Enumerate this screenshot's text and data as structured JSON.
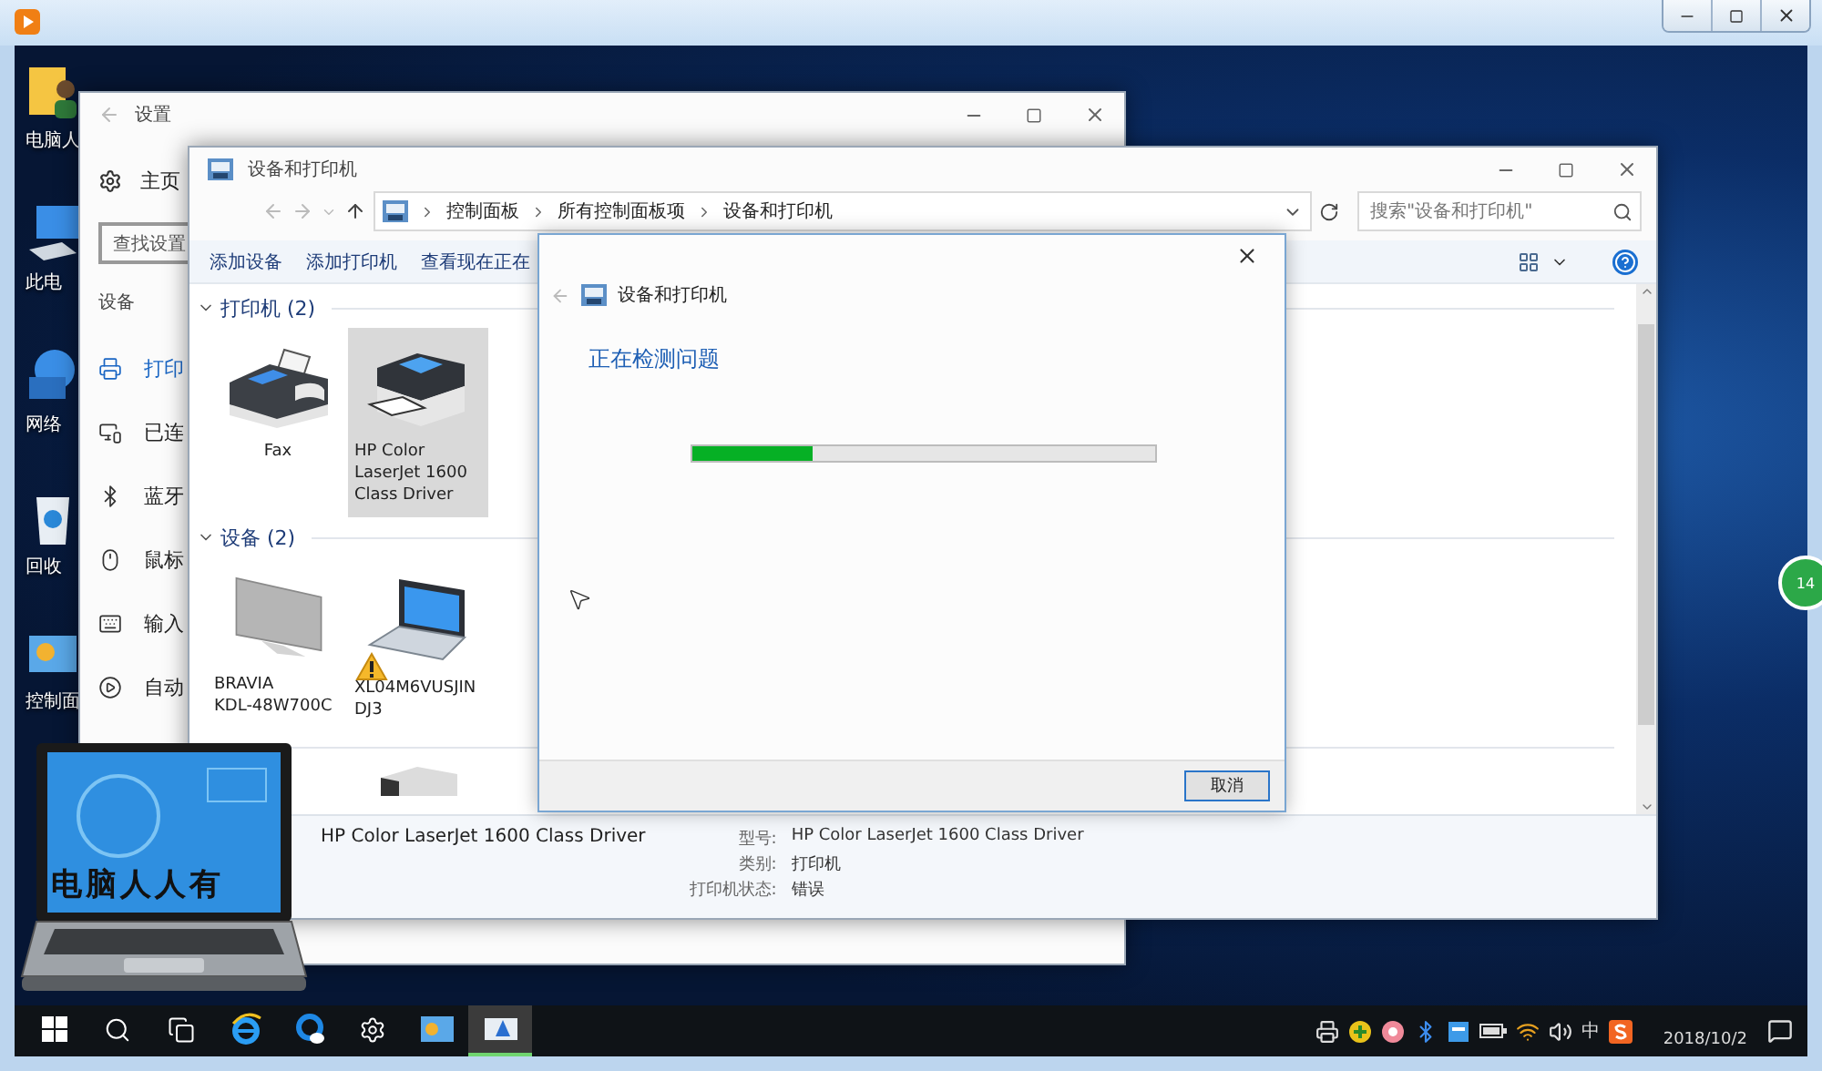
{
  "badge": {
    "text": "14"
  },
  "desktop_icons": [
    {
      "kind": "user-folder",
      "label": "电脑人"
    },
    {
      "kind": "pc",
      "label": "此电"
    },
    {
      "kind": "network",
      "label": "网络"
    },
    {
      "kind": "recycle",
      "label": "回收"
    },
    {
      "kind": "control-panel",
      "label": "控制面"
    }
  ],
  "settings_window": {
    "title": "设置",
    "home": "主页",
    "search": {
      "placeholder": "查找设置"
    },
    "section": "设备",
    "nav": [
      {
        "kind": "printer",
        "label": "打印",
        "selected": true
      },
      {
        "kind": "devices",
        "label": "已连",
        "selected": false
      },
      {
        "kind": "bluetooth",
        "label": "蓝牙",
        "selected": false
      },
      {
        "kind": "mouse",
        "label": "鼠标",
        "selected": false
      },
      {
        "kind": "keyboard",
        "label": "输入",
        "selected": false
      },
      {
        "kind": "autoplay",
        "label": "自动",
        "selected": false
      }
    ]
  },
  "explorer": {
    "title": "设备和打印机",
    "breadcrumb": [
      "控制面板",
      "所有控制面板项",
      "设备和打印机"
    ],
    "search": {
      "placeholder": "搜索\"设备和打印机\""
    },
    "toolbar": [
      "添加设备",
      "添加打印机",
      "查看现在正在"
    ],
    "groups": [
      {
        "title": "打印机 (2)",
        "expanded": true,
        "items": [
          {
            "kind": "fax",
            "label": [
              "Fax"
            ],
            "selected": false,
            "warning": false
          },
          {
            "kind": "printer",
            "label": [
              "HP Color",
              "LaserJet 1600",
              "Class Driver"
            ],
            "selected": true,
            "warning": false
          }
        ]
      },
      {
        "title": "设备 (2)",
        "expanded": true,
        "items": [
          {
            "kind": "tv",
            "label": [
              "BRAVIA",
              "KDL-48W700C"
            ],
            "selected": false,
            "warning": false
          },
          {
            "kind": "laptop",
            "label": [
              "XL04M6VUSJIN",
              "DJ3"
            ],
            "selected": false,
            "warning": true
          }
        ]
      },
      {
        "items": [
          {
            "kind": "tower",
            "selected": false,
            "warning": false
          }
        ]
      }
    ],
    "details": {
      "name": "HP Color LaserJet 1600 Class Driver",
      "fields": [
        {
          "label": "型号:",
          "value": "HP Color LaserJet 1600 Class Driver"
        },
        {
          "label": "类别:",
          "value": "打印机"
        },
        {
          "label": "打印机状态:",
          "value": "错误"
        }
      ]
    }
  },
  "dialog": {
    "title": "设备和打印机",
    "heading": "正在检测问题",
    "progress": {
      "level": 0.26
    },
    "cancel": "取消"
  },
  "logo": {
    "text": "电脑人人有"
  },
  "taskbar": {
    "apps": [
      {
        "kind": "start",
        "active": false
      },
      {
        "kind": "search",
        "active": false
      },
      {
        "kind": "taskview",
        "active": false
      },
      {
        "kind": "ie",
        "active": false
      },
      {
        "kind": "cortana",
        "active": false
      },
      {
        "kind": "settings",
        "active": false
      },
      {
        "kind": "control-panel",
        "active": false
      },
      {
        "kind": "devices",
        "active": true
      }
    ],
    "ime": "中",
    "date": "2018/10/2"
  }
}
